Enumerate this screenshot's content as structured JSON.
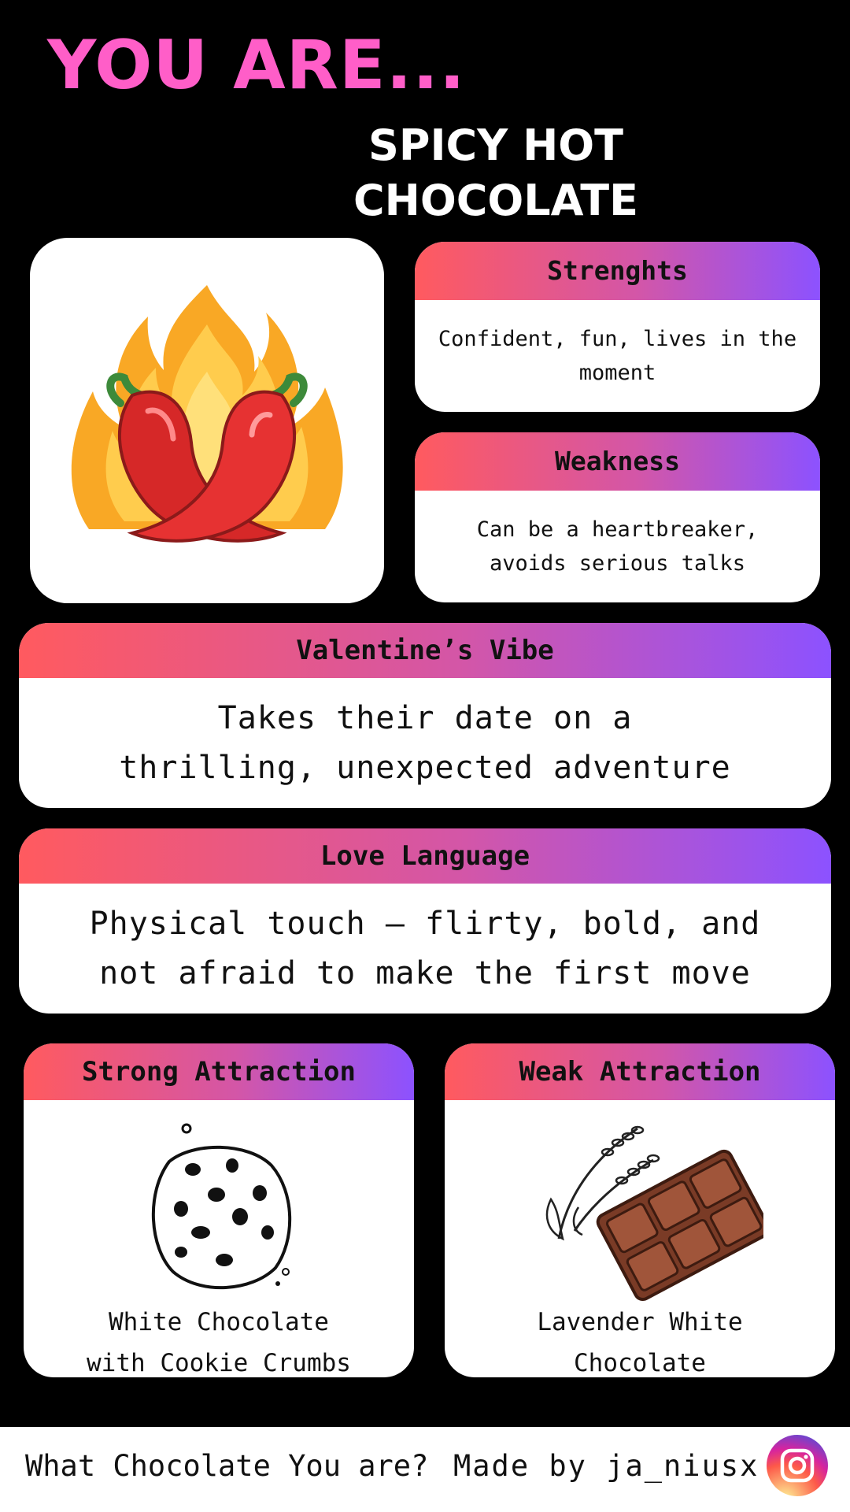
{
  "header": {
    "you_are": "YOU ARE...",
    "result_line1": "SPICY HOT",
    "result_line2": "CHOCOLATE"
  },
  "image_card": {
    "icon": "flaming-chili-peppers-icon"
  },
  "strengths": {
    "title": "Strenghts",
    "text": "Confident, fun, lives in the moment"
  },
  "weakness": {
    "title": "Weakness",
    "text": "Can be a heartbreaker, avoids serious talks"
  },
  "valentines_vibe": {
    "title": "Valentine’s Vibe",
    "text": "Takes their date on a thrilling, unexpected adventure"
  },
  "love_language": {
    "title": "Love Language",
    "text": "Physical touch – flirty, bold, and not afraid to make the first move"
  },
  "strong_attraction": {
    "title": "Strong Attraction",
    "line1": "White Chocolate",
    "line2": "with Cookie Crumbs",
    "icon": "cookie-icon"
  },
  "weak_attraction": {
    "title": "Weak Attraction",
    "line1": "Lavender White",
    "line2": "Chocolate",
    "icon": "lavender-chocolate-bar-icon"
  },
  "footer": {
    "question": "What Chocolate You are?",
    "credit": "Made by ja_niusx",
    "icon": "instagram-icon"
  },
  "colors": {
    "accent_pink": "#ff5ec8",
    "gradient_start": "#ff5a5f",
    "gradient_end": "#8c52ff",
    "background": "#000000"
  }
}
